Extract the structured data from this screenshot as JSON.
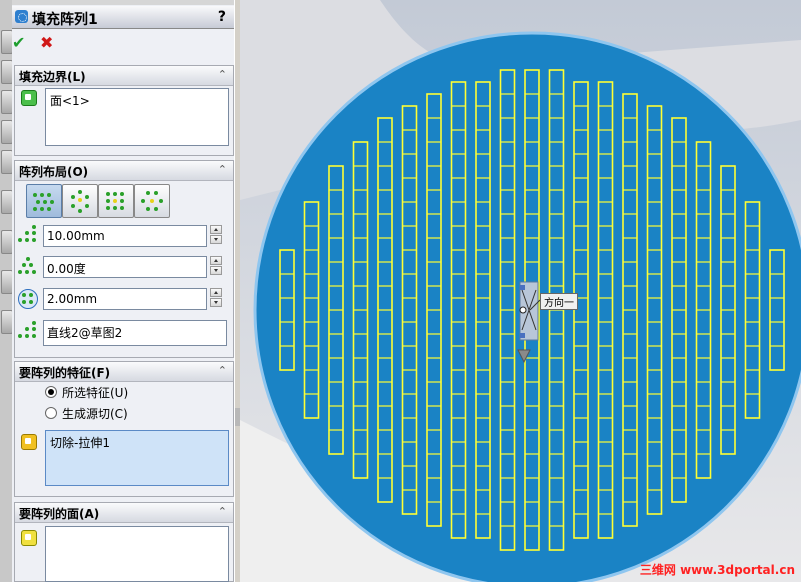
{
  "feature_title": "填充阵列1",
  "help_label": "?",
  "ok_label": "✔",
  "cancel_label": "✖",
  "fill_boundary": {
    "header": "填充边界(L)",
    "items": [
      "面<1>"
    ]
  },
  "pattern_layout": {
    "header": "阵列布局(O)",
    "spacing": "10.00mm",
    "angle": "0.00度",
    "margin": "2.00mm",
    "direction": "直线2@草图2"
  },
  "features_to_pattern": {
    "header": "要阵列的特征(F)",
    "option_selected_label": "所选特征(U)",
    "option_seed_label": "生成源切(C)",
    "selected_option": "所选特征(U)",
    "items": [
      "切除-拉伸1"
    ]
  },
  "faces_to_pattern": {
    "header": "要阵列的面(A)",
    "items": []
  },
  "viewport": {
    "direction_label": "方向一",
    "watermark": "三维网 www.3dportal.cn",
    "colors": {
      "disk": "#1a83c5",
      "disk_edge": "#8fc6ef",
      "slot": "#ffff33"
    }
  }
}
